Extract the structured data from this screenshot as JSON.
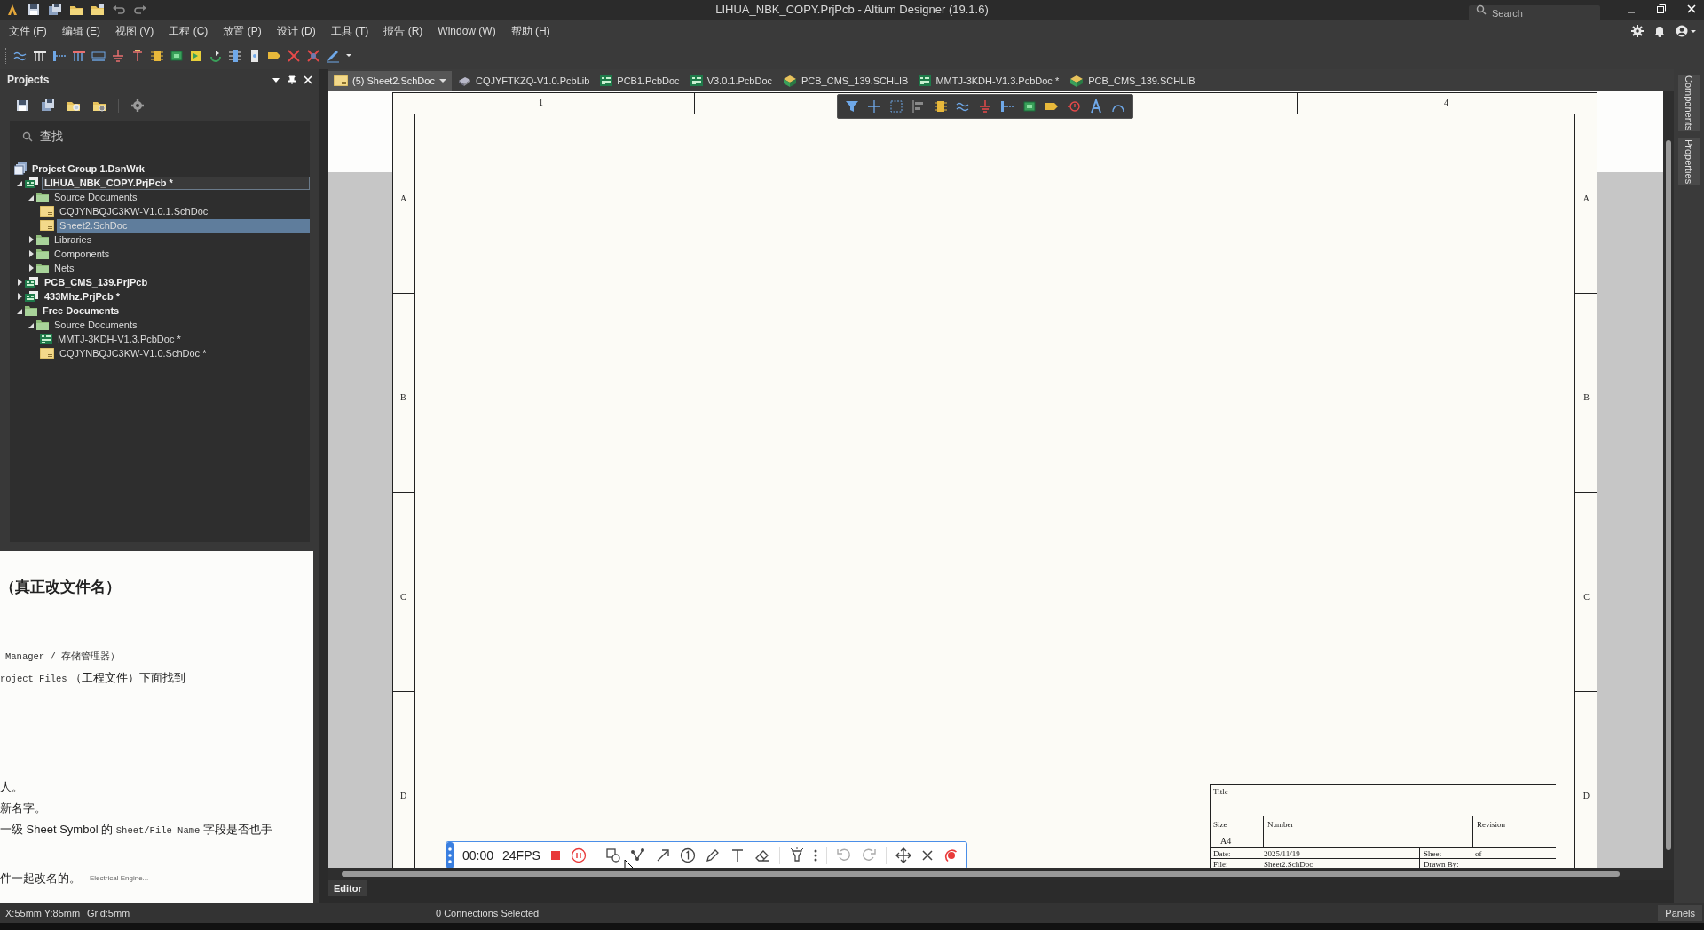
{
  "window": {
    "title": "LIHUA_NBK_COPY.PrjPcb - Altium Designer (19.1.6)",
    "search": {
      "placeholder": "Search"
    }
  },
  "menu": [
    "文件 (F)",
    "编辑 (E)",
    "视图 (V)",
    "工程 (C)",
    "放置 (P)",
    "设计 (D)",
    "工具 (T)",
    "报告 (R)",
    "Window (W)",
    "帮助 (H)"
  ],
  "projects_panel": {
    "title": "Projects",
    "search": {
      "placeholder": "查找"
    },
    "tree": [
      {
        "label": "Project Group 1.DsnWrk",
        "kind": "workspace",
        "selected": false,
        "focused": false
      },
      {
        "label": "LIHUA_NBK_COPY.PrjPcb *",
        "kind": "project",
        "expanded": true,
        "selected": false,
        "focused": true,
        "children": [
          {
            "label": "Source Documents",
            "kind": "folder",
            "expanded": true,
            "selected": false,
            "focused": false,
            "children": [
              {
                "label": "CQJYNBQJC3KW-V1.0.1.SchDoc",
                "kind": "schdoc",
                "selected": false,
                "focused": false
              },
              {
                "label": "Sheet2.SchDoc",
                "kind": "schdoc",
                "selected": true,
                "focused": false
              }
            ]
          },
          {
            "label": "Libraries",
            "kind": "folder",
            "expanded": false,
            "selected": false,
            "focused": false
          },
          {
            "label": "Components",
            "kind": "folder",
            "expanded": false,
            "selected": false,
            "focused": false
          },
          {
            "label": "Nets",
            "kind": "folder",
            "expanded": false,
            "selected": false,
            "focused": false
          }
        ]
      },
      {
        "label": "PCB_CMS_139.PrjPcb",
        "kind": "project",
        "expanded": false,
        "selected": false,
        "focused": false
      },
      {
        "label": "433Mhz.PrjPcb *",
        "kind": "project",
        "expanded": false,
        "selected": false,
        "focused": false
      },
      {
        "label": "Free Documents",
        "kind": "free",
        "expanded": true,
        "selected": false,
        "focused": false,
        "children": [
          {
            "label": "Source Documents",
            "kind": "folder",
            "expanded": true,
            "selected": false,
            "focused": false,
            "children": [
              {
                "label": "MMTJ-3KDH-V1.3.PcbDoc *",
                "kind": "pcbdoc",
                "selected": false,
                "focused": false
              },
              {
                "label": "CQJYNBQJC3KW-V1.0.SchDoc *",
                "kind": "schdoc",
                "selected": false,
                "focused": false
              }
            ]
          }
        ]
      }
    ]
  },
  "document_tabs": [
    {
      "label": "(5) Sheet2.SchDoc",
      "kind": "schdoc",
      "selected": true
    },
    {
      "label": "CQJYFTKZQ-V1.0.PcbLib",
      "kind": "pcblib",
      "selected": false
    },
    {
      "label": "PCB1.PcbDoc",
      "kind": "pcbdoc",
      "selected": false
    },
    {
      "label": "V3.0.1.PcbDoc",
      "kind": "pcbdoc",
      "selected": false
    },
    {
      "label": "PCB_CMS_139.SCHLIB",
      "kind": "schlib",
      "selected": false
    },
    {
      "label": "MMTJ-3KDH-V1.3.PcbDoc *",
      "kind": "pcbdoc",
      "selected": false
    },
    {
      "label": "PCB_CMS_139.SCHLIB",
      "kind": "schlib",
      "selected": false
    }
  ],
  "sheet": {
    "column_labels": [
      "1",
      "4"
    ],
    "row_labels_left": [
      "A",
      "B",
      "C",
      "D"
    ],
    "row_labels_right": [
      "A",
      "B",
      "C",
      "D"
    ],
    "title_block": {
      "title_label": "Title",
      "size_label": "Size",
      "size": "A4",
      "number_label": "Number",
      "revision_label": "Revision",
      "date_label": "Date:",
      "date": "2025/11/19",
      "sheet_label": "Sheet",
      "of_label": "of",
      "file_label": "File:",
      "file": "Sheet2.SchDoc",
      "drawn_by_label": "Drawn By:"
    }
  },
  "recorder": {
    "time": "00:00",
    "fps": "24FPS"
  },
  "note_overlay": {
    "lines": [
      [
        {
          "text": "（真正改文件名）",
          "kind": "heading"
        }
      ],
      [
        {
          "text": "Manager / 存储管理器）",
          "kind": "mono"
        }
      ],
      [
        {
          "text": "roject Files",
          "kind": "mono"
        },
        {
          "text": " （工程文件）下面找到",
          "kind": "plain"
        }
      ],
      [
        {
          "text": "人。",
          "kind": "plain"
        }
      ],
      [
        {
          "text": "新名字。",
          "kind": "plain"
        }
      ],
      [
        {
          "text": "一级 Sheet Symbol 的 ",
          "kind": "plain"
        },
        {
          "text": "Sheet/File Name",
          "kind": "mono"
        },
        {
          "text": " 字段是否也手",
          "kind": "plain"
        }
      ],
      [
        {
          "text": "件一起改名的。",
          "kind": "plain"
        }
      ]
    ],
    "source": "Electrical Engine..."
  },
  "bottom_tabs": [
    {
      "label": "Editor",
      "selected": true
    }
  ],
  "side_tabs": [
    "Components",
    "Properties"
  ],
  "status_bar": {
    "position": "X:55mm Y:85mm",
    "grid": "Grid:5mm",
    "selection": "0 Connections Selected",
    "panels_button": "Panels"
  }
}
